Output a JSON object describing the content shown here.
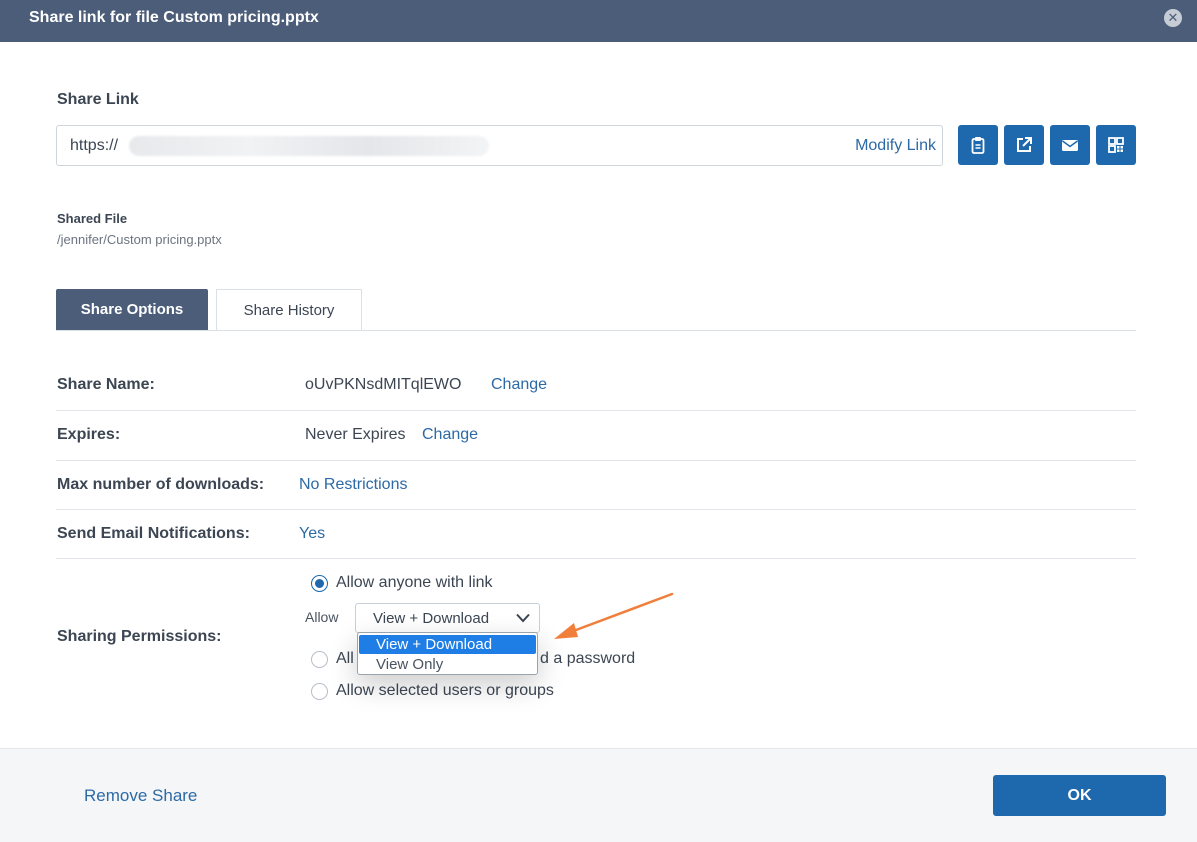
{
  "dialog": {
    "title": "Share link for file Custom pricing.pptx",
    "close_icon": "close-circle-icon"
  },
  "share_link": {
    "label": "Share Link",
    "url_prefix": "https://",
    "modify_label": "Modify Link",
    "actions": [
      {
        "name": "copy-link-button",
        "icon": "clipboard-icon"
      },
      {
        "name": "open-link-button",
        "icon": "external-link-icon"
      },
      {
        "name": "email-link-button",
        "icon": "envelope-icon"
      },
      {
        "name": "qr-code-button",
        "icon": "qr-code-icon"
      }
    ]
  },
  "shared_file": {
    "label": "Shared File",
    "path": "/jennifer/Custom pricing.pptx"
  },
  "tabs": [
    {
      "label": "Share Options",
      "active": true
    },
    {
      "label": "Share History",
      "active": false
    }
  ],
  "options": {
    "share_name": {
      "label": "Share Name:",
      "value": "oUvPKNsdMITqlEWO",
      "action": "Change"
    },
    "expires": {
      "label": "Expires:",
      "value": "Never Expires",
      "action": "Change"
    },
    "max_downloads": {
      "label": "Max number of downloads:",
      "value": "No Restrictions"
    },
    "email_notifications": {
      "label": "Send Email Notifications:",
      "value": "Yes"
    },
    "sharing_permissions": {
      "label": "Sharing Permissions:",
      "radio_1": "Allow anyone with link",
      "radio_2_start": "All",
      "radio_2_end": "d a password",
      "radio_3": "Allow selected users or groups",
      "allow_label": "Allow",
      "selected": "View + Download",
      "dropdown_options": [
        "View + Download",
        "View Only"
      ]
    }
  },
  "footer": {
    "remove_label": "Remove Share",
    "ok_label": "OK"
  },
  "colors": {
    "header": "#4c5d7a",
    "accent": "#1e68ad",
    "link": "#2c6aa6",
    "annotation_arrow": "#f07f3c",
    "dropdown_highlight": "#1e7ee6"
  }
}
